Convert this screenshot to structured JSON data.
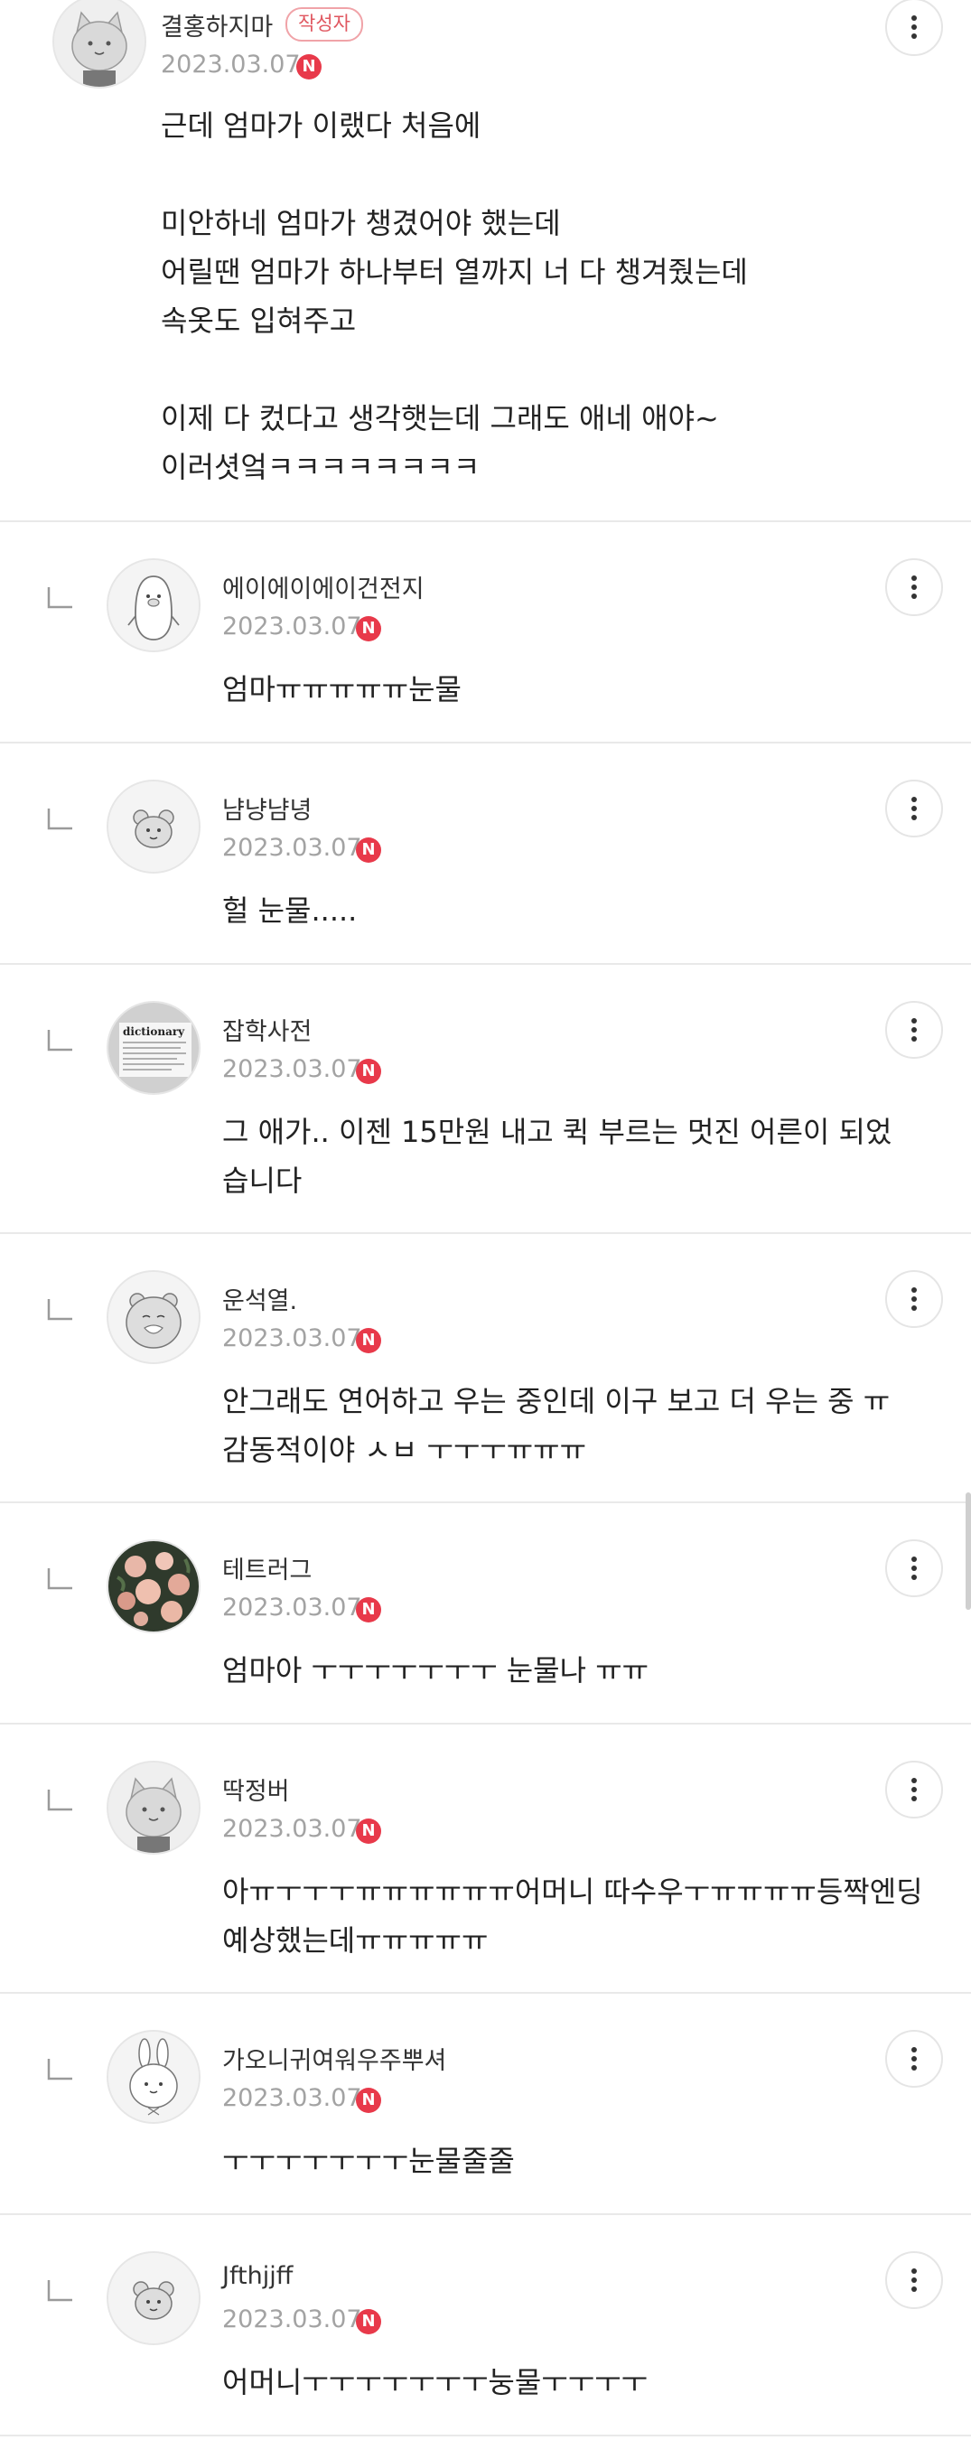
{
  "top_comment": {
    "author": "결홍하지마",
    "writer_badge": "작성자",
    "date": "2023.03.07",
    "new_badge": "N",
    "body": "근데 엄마가 이랬다 처음에\n\n미안하네 엄마가 챙겼어야 했는데\n어릴땐 엄마가 하나부터 열까지 너 다 챙겨줬는데\n속옷도 입혀주고\n\n이제 다 컸다고 생각햇는데 그래도 애네 애야~\n이러셧엌ㅋㅋㅋㅋㅋㅋㅋㅋ"
  },
  "replies": [
    {
      "author": "에이에이에이건전지",
      "date": "2023.03.07",
      "new_badge": "N",
      "body": "엄마ㅠㅠㅠㅠㅠ눈물",
      "avatar_icon": "penguin-avatar-icon"
    },
    {
      "author": "냠냥냠녕",
      "date": "2023.03.07",
      "new_badge": "N",
      "body": "헐 눈물.....",
      "avatar_icon": "bear-avatar-icon"
    },
    {
      "author": "잡학사전",
      "date": "2023.03.07",
      "new_badge": "N",
      "body": "그 애가.. 이젠 15만원 내고 퀵 부르는 멋진 어른이 되었\n습니다",
      "avatar_icon": "dictionary-photo-avatar",
      "avatar_text": "dictionary"
    },
    {
      "author": "운석열.",
      "date": "2023.03.07",
      "new_badge": "N",
      "body": "안그래도 연어하고 우는 중인데 이구 보고 더 우는 중 ㅠ\n감동적이야 ㅅㅂ ㅜㅜㅜㅠㅠㅠ",
      "avatar_icon": "sleepy-hamster-avatar-icon"
    },
    {
      "author": "테트러그",
      "date": "2023.03.07",
      "new_badge": "N",
      "body": "엄마아 ㅜㅜㅜㅜㅜㅜㅜ 눈물나 ㅠㅠ",
      "avatar_icon": "flower-photo-avatar"
    },
    {
      "author": "딱정버",
      "date": "2023.03.07",
      "new_badge": "N",
      "body": "아ㅠㅜㅜㅜㅠㅠㅠㅠㅠㅠ어머니 따수우ㅜㅠㅠㅠㅠ등짝엔딩\n예상했는데ㅠㅠㅠㅠㅠ",
      "avatar_icon": "cat-avatar-icon"
    },
    {
      "author": "가오니귀여워우주뿌셔",
      "date": "2023.03.07",
      "new_badge": "N",
      "body": "ㅜㅜㅜㅜㅜㅜㅜ눈물줄줄",
      "avatar_icon": "rabbit-avatar-icon"
    },
    {
      "author": "Jfthjjff",
      "date": "2023.03.07",
      "new_badge": "N",
      "body": "어머니ㅜㅜㅜㅜㅜㅜㅜ눙물ㅜㅜㅜㅜ",
      "avatar_icon": "bear-avatar-icon"
    }
  ],
  "colors": {
    "new_badge": "#e8394a",
    "writer_badge": "#e05760",
    "date": "#a3a3a3",
    "divider": "#e9e9e9"
  }
}
